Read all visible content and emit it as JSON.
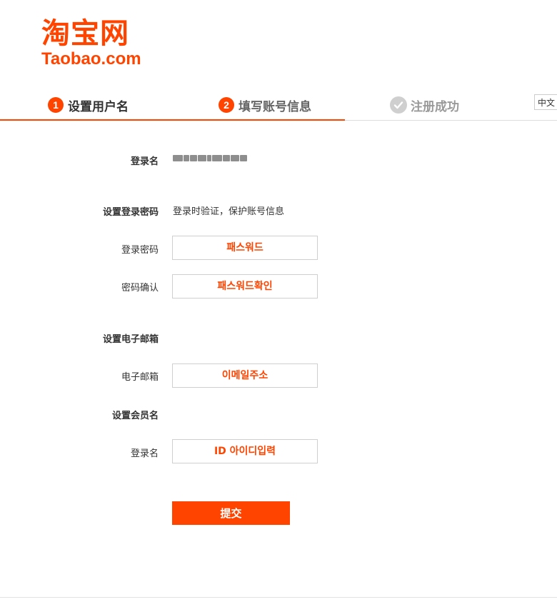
{
  "logo": {
    "chinese": "淘宝网",
    "english": "Taobao.com"
  },
  "steps": [
    {
      "num": "1",
      "label": "设置用户名"
    },
    {
      "num": "2",
      "label": "填写账号信息"
    },
    {
      "label": "注册成功"
    }
  ],
  "language_button": "中文",
  "form": {
    "login_name_label": "登录名",
    "password_section_label": "设置登录密码",
    "password_section_hint": "登录时验证，保护账号信息",
    "password_label": "登录密码",
    "password_placeholder": "패스워드",
    "confirm_label": "密码确认",
    "confirm_placeholder": "패스워드확인",
    "email_section_label": "设置电子邮箱",
    "email_label": "电子邮箱",
    "email_placeholder": "이메일주소",
    "member_section_label": "设置会员名",
    "member_label": "登录名",
    "member_placeholder": "ID 아이디입력",
    "submit_label": "提交"
  },
  "colors": {
    "accent": "#ff4400",
    "check_gray": "#cfcfcf"
  },
  "icons": {
    "step3": "check-circle-icon"
  }
}
